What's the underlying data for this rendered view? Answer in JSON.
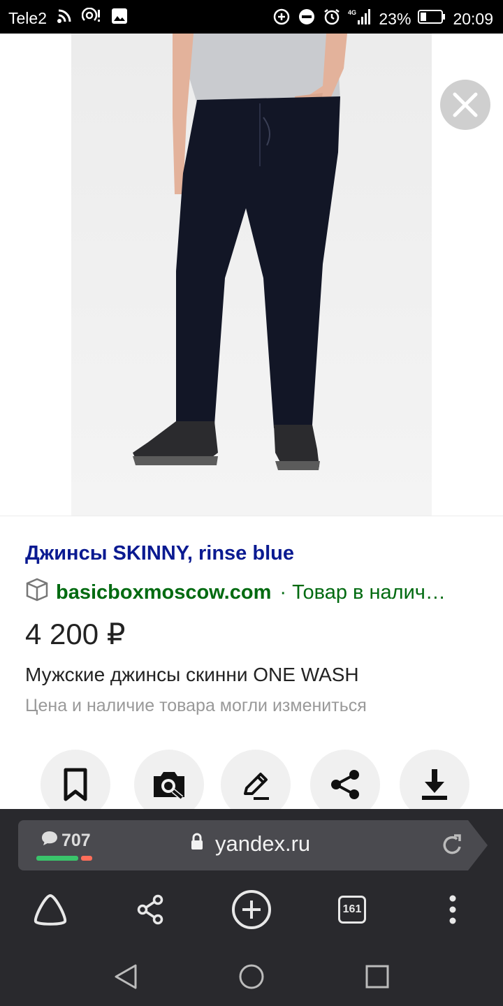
{
  "status_bar": {
    "carrier": "Tele2",
    "battery_percent": "23%",
    "time": "20:09",
    "network": "4G",
    "icons": [
      "wifi-icon",
      "hotspot-icon",
      "image-icon",
      "data-saver-icon",
      "dnd-icon",
      "alarm-icon",
      "signal-icon",
      "battery-icon"
    ]
  },
  "product": {
    "title": "Джинсы SKINNY, rinse blue",
    "source": "basicboxmoscow.com",
    "availability": "· Товар в налич…",
    "price": "4 200 ₽",
    "description": "Мужские джинсы скинни ONE WASH",
    "note": "Цена и наличие товара могли измениться"
  },
  "actions": [
    "bookmark-icon",
    "camera-search-icon",
    "edit-icon",
    "share-icon",
    "download-icon"
  ],
  "browser": {
    "comments_count": "707",
    "url": "yandex.ru",
    "tabs_count": "161"
  },
  "colors": {
    "title_link": "#0a1a91",
    "source_green": "#006a10",
    "toolbar_bg": "#29292d",
    "omnibox_bg": "#4a4a4f"
  }
}
